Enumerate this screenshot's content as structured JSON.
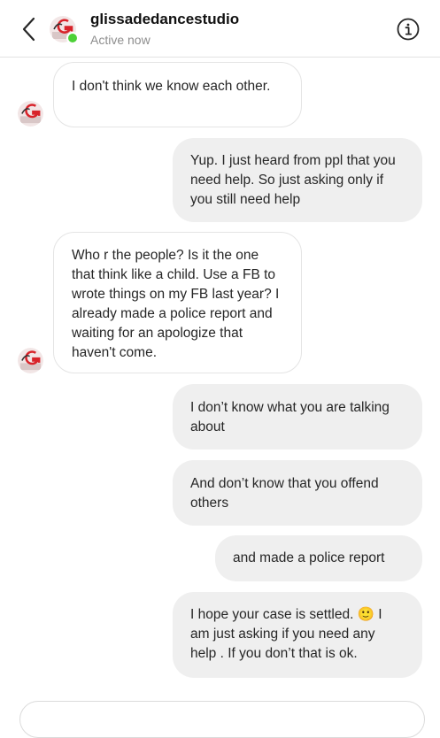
{
  "header": {
    "username": "glissadedancestudio",
    "status": "Active now",
    "back_icon": "chevron-left-icon",
    "info_icon": "info-circle-icon",
    "online_color": "#4cd137"
  },
  "messages": [
    {
      "from": "them",
      "text": "I don't think we know each other."
    },
    {
      "from": "me",
      "text": "Yup. I just heard from ppl that you need help. So just asking only if you still need help"
    },
    {
      "from": "them",
      "text": "Who r the people? Is it the one that think like a child. Use a FB to wrote things on my FB last year? I already made a police report and waiting for an apologize that haven't come."
    },
    {
      "from": "me",
      "text": "I don’t know what you are talking about"
    },
    {
      "from": "me",
      "text": "And don’t know that you offend others"
    },
    {
      "from": "me",
      "text": "and made a police report"
    },
    {
      "from": "me",
      "text": "I hope your case is settled. 🙂 I am just asking if you need any help . If you don’t that is ok."
    }
  ],
  "colors": {
    "sent_bubble": "#efefef",
    "received_border": "#e4e4e4",
    "text": "#262626",
    "muted": "#8e8e8e"
  }
}
